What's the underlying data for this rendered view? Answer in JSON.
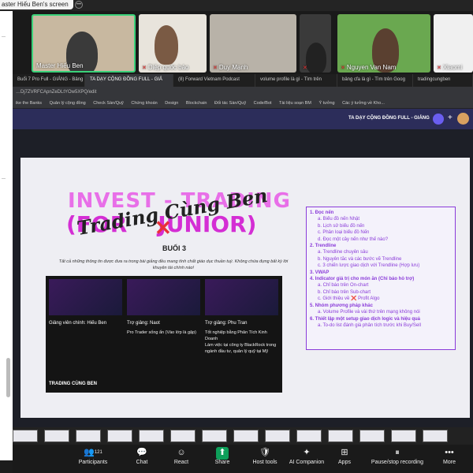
{
  "meeting": {
    "share_banner": "aster Hiếu Ben's screen",
    "participants_count": "121",
    "participants": [
      {
        "name": "Master Hiếu Ben",
        "muted": false
      },
      {
        "name": "Diệp quốc bảo",
        "muted": true
      },
      {
        "name": "Duy Mạnh",
        "muted": true
      },
      {
        "name": "",
        "muted": true
      },
      {
        "name": "Nguyen Van Nam",
        "muted": true
      },
      {
        "name": "Xiaomi",
        "muted": true
      }
    ]
  },
  "browser": {
    "tabs": [
      "Buổi 7 Pro Full - GIẢNG - Bảng",
      "TA DẠY CỘNG ĐỒNG FULL - GIẢ",
      "(8) Forward Vietnam Podcast",
      "volume profile là gì - Tìm trên",
      "bảng cfa là gì - Tìm trên Goog",
      "tradingcungben"
    ],
    "url": "…Dj7ZVRFCApnZeDLtYOw5XPQ/edit",
    "bookmarks": [
      "ike the Banks",
      "Quản lý cộng đồng",
      "Check Sàn/Quỹ",
      "Chứng khoán",
      "Design",
      "Blockchain",
      "Đối tác Sàn/Quỹ",
      "Code/Bot",
      "Tài liệu soạn BM",
      "Ý tưởng",
      "Các ý tưởng về Kho..."
    ]
  },
  "app": {
    "doc_title": "TA DẠY CỘNG ĐỒNG FULL - GIẢNG"
  },
  "slide": {
    "logo_top": "INVEST - TRADING",
    "logo_bottom": "(FOR    JUNIOR)",
    "logo_script": "Trading Cùng Ben",
    "session": "BUỔI 3",
    "intro": "Tất cả những thông tin được đưa ra trong bài giảng đều mang tính chất giáo dục thuần tuý. Không chứa đựng bất kỳ lời khuyên tài chính nào!",
    "cards": [
      {
        "role": "Giảng viên chính: Hiếu Ben",
        "desc": ""
      },
      {
        "role": "Trợ giảng: Naot",
        "desc": "Pro Trader sống ẩn (Vào lớp là gặp)"
      },
      {
        "role": "Trợ giảng: Phu Tran",
        "desc": "Tốt nghiệp bằng Phân Tích Kinh Doanh\nLàm việc tại công ty BlackRock trong ngành đầu tư, quản lý quỹ tại Mỹ"
      }
    ],
    "brand": "TRADING CÙNG BEN",
    "toc": [
      {
        "type": "h",
        "text": "1. Đọc nến"
      },
      {
        "type": "s",
        "text": "a. Biểu đồ nến Nhật"
      },
      {
        "type": "s",
        "text": "b. Lịch sử biểu đồ nến"
      },
      {
        "type": "s",
        "text": "c. Phân loại biểu đồ Nến"
      },
      {
        "type": "s",
        "text": "d. Đọc một cây nến như thế nào?"
      },
      {
        "type": "h",
        "text": "2. Trendline"
      },
      {
        "type": "s",
        "text": "a. Trendline chuyên sâu"
      },
      {
        "type": "s",
        "text": "b. Nguyên tắc và các bước vẽ Trendline"
      },
      {
        "type": "s",
        "text": "c. 3 chiến lược giao dịch với Trendline (Hợp lưu)"
      },
      {
        "type": "h",
        "text": "3. VWAP"
      },
      {
        "type": "h",
        "text": "4. Indicator giá trị cho món ăn (Chỉ báo hỗ trợ)"
      },
      {
        "type": "s",
        "text": "a. Chỉ báo trên On-chart"
      },
      {
        "type": "s",
        "text": "b. Chỉ báo trên Sub-chart"
      },
      {
        "type": "s",
        "text": "c. Giới thiệu về ❌ Profit Algo"
      },
      {
        "type": "h",
        "text": "5. Nhóm phương pháp khác"
      },
      {
        "type": "s",
        "text": "a. Volume Profile và vài thứ trên mạng không nói"
      },
      {
        "type": "h",
        "text": "6. Thiết lập một setup giao dịch logic và hiệu quả"
      },
      {
        "type": "s",
        "text": "a. To-do list đánh giá phân tích trước khi Buy/Sell"
      }
    ]
  },
  "controls": [
    {
      "label": "Participants",
      "icon": "participants-icon",
      "glyph": "👥"
    },
    {
      "label": "Chat",
      "icon": "chat-icon",
      "glyph": "💬"
    },
    {
      "label": "React",
      "icon": "react-icon",
      "glyph": "☺"
    },
    {
      "label": "Share",
      "icon": "share-icon",
      "glyph": "⬆"
    },
    {
      "label": "Host tools",
      "icon": "shield-icon",
      "glyph": "🛡"
    },
    {
      "label": "AI Companion",
      "icon": "ai-companion-icon",
      "glyph": "✦"
    },
    {
      "label": "Apps",
      "icon": "apps-icon",
      "glyph": "⊞"
    },
    {
      "label": "Pause/stop recording",
      "icon": "recording-icon",
      "glyph": "⏸"
    },
    {
      "label": "More",
      "icon": "more-icon",
      "glyph": "•••"
    }
  ]
}
